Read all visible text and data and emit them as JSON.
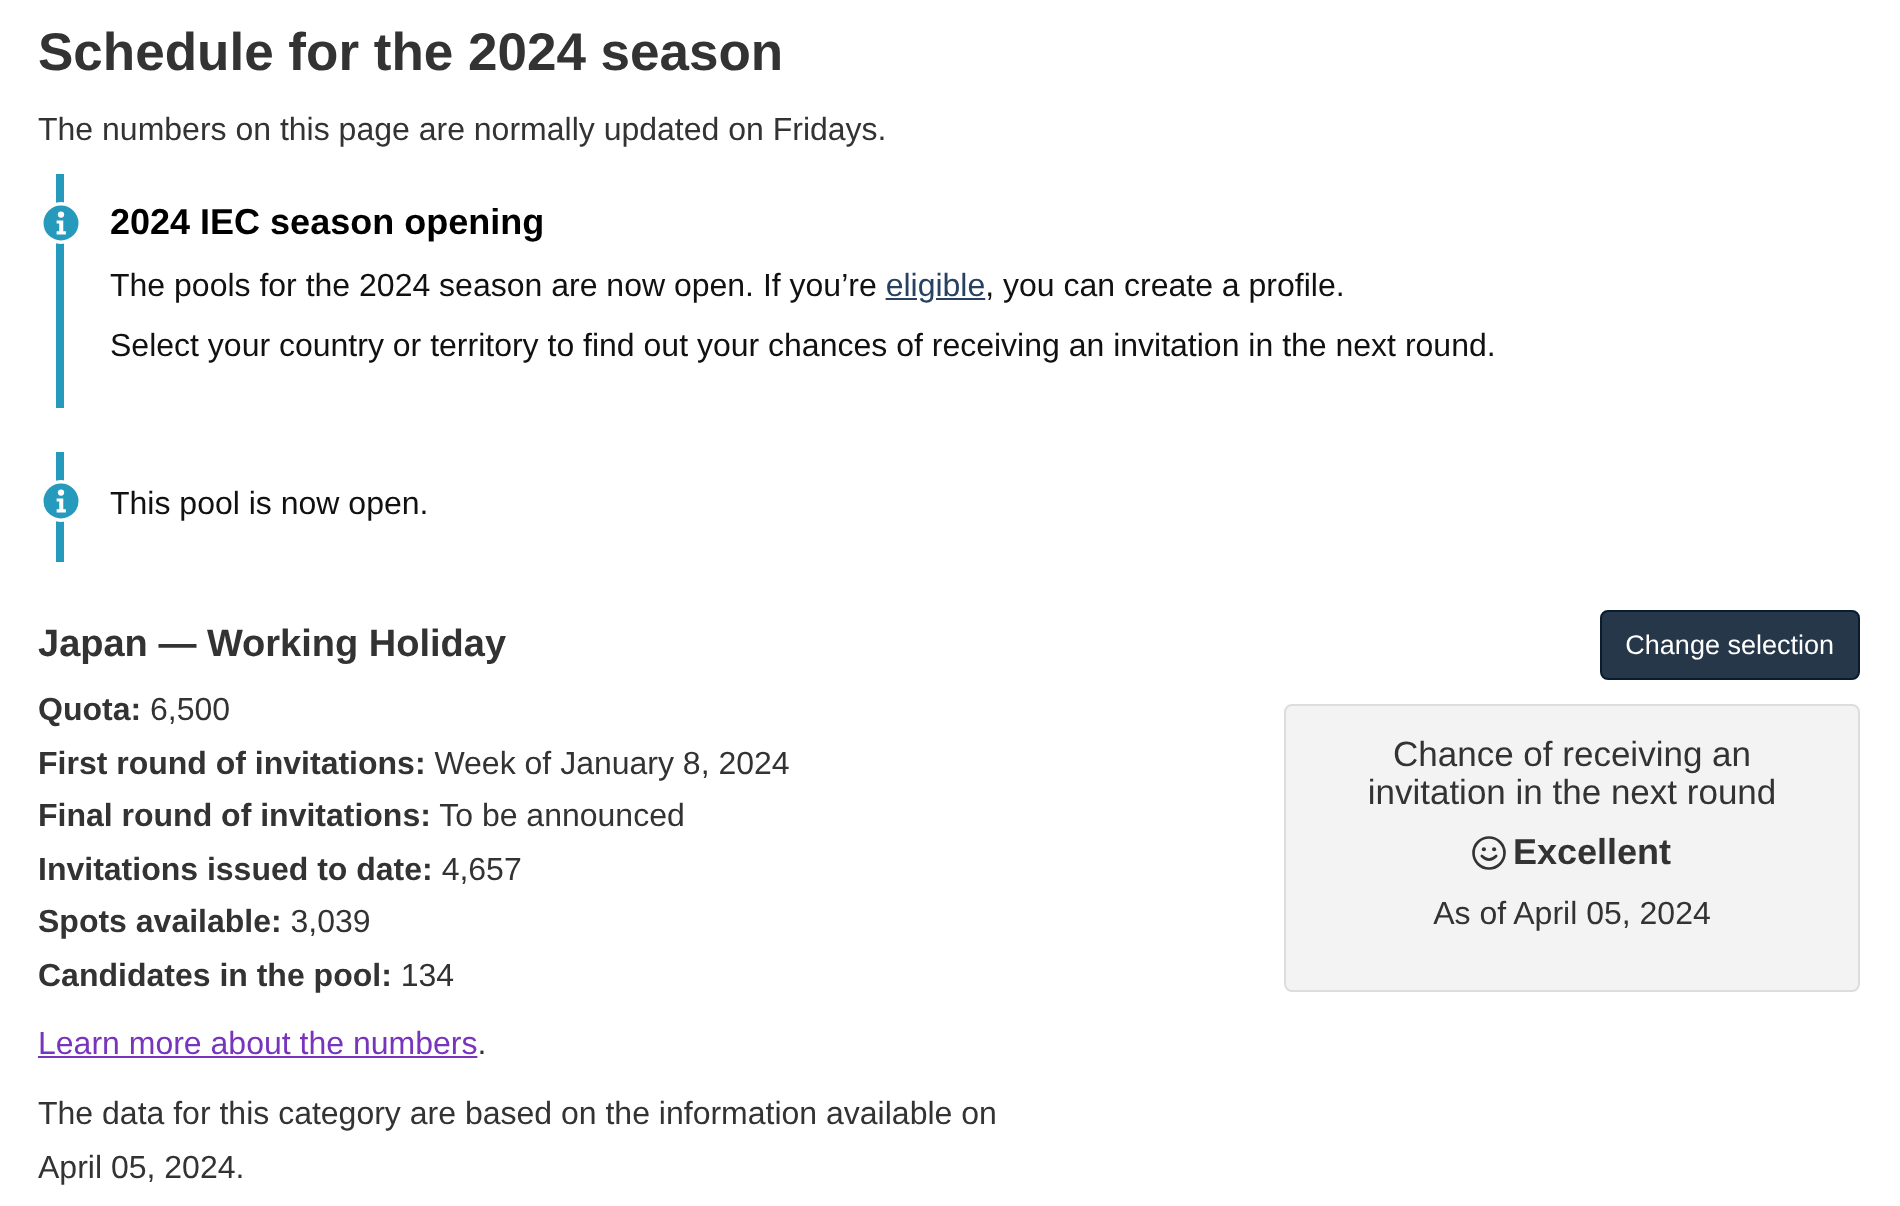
{
  "title": "Schedule for the 2024 season",
  "intro": "The numbers on this page are normally updated on Fridays.",
  "alerts": [
    {
      "kind": "info",
      "heading": "2024 IEC season opening",
      "paragraphs": [
        {
          "before": "The pools for the 2024 season are now open. If you’re ",
          "link": {
            "text": "eligible",
            "visited": false
          },
          "after": ", you can create a profile."
        },
        {
          "before": "Select your country or territory to find out your chances of receiving an invitation in the next round."
        }
      ]
    },
    {
      "kind": "info",
      "paragraphs": [
        {
          "before": "This pool is now open."
        }
      ]
    }
  ],
  "pool": {
    "heading": "Japan — Working Holiday",
    "button": "Change selection",
    "facts": [
      {
        "label": "Quota:",
        "value": "6,500"
      },
      {
        "label": "First round of invitations:",
        "value": "Week of January 8, 2024"
      },
      {
        "label": "Final round of invitations:",
        "value": "To be announced"
      },
      {
        "label": "Invitations issued to date:",
        "value": "4,657"
      },
      {
        "label": "Spots available:",
        "value": "3,039"
      },
      {
        "label": "Candidates in the pool:",
        "value": "134"
      }
    ],
    "more": {
      "link": {
        "text": "Learn more about the numbers",
        "visited": true
      },
      "after": "."
    },
    "note": "The data for this category are based on the information available on April 05, 2024.",
    "chance_card": {
      "title": "Chance of receiving an invitation in the next round",
      "rating": "Excellent",
      "as_of": "As of April 05, 2024"
    }
  }
}
